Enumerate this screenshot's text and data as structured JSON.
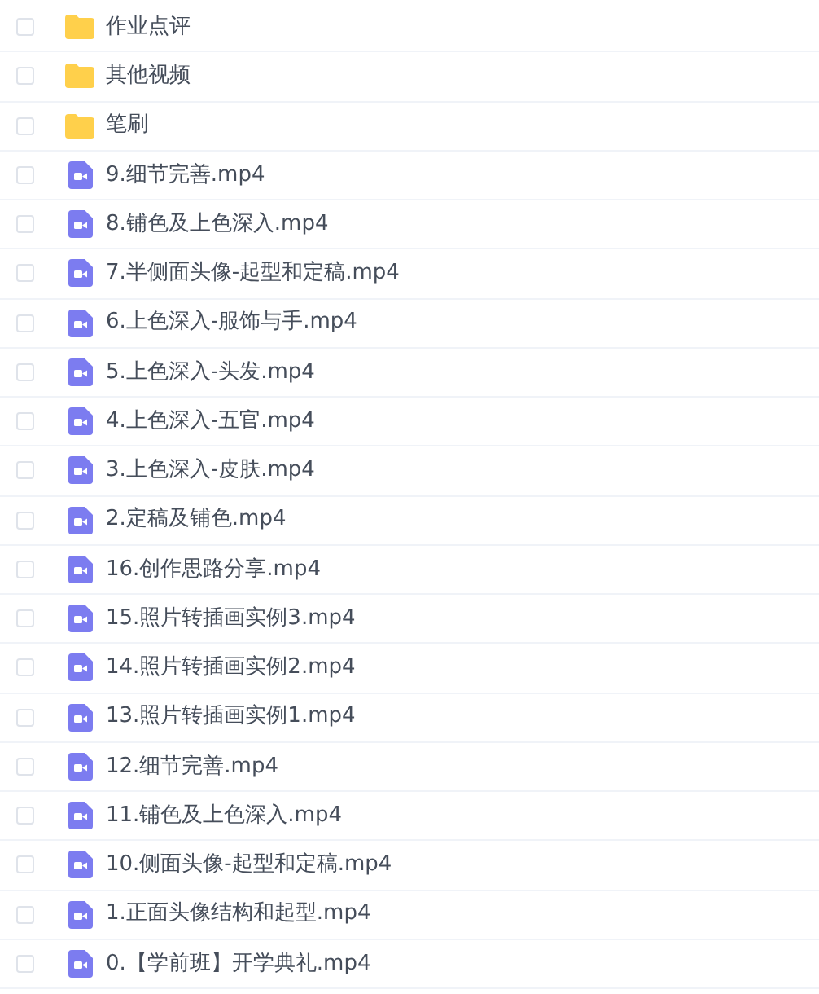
{
  "files": [
    {
      "kind": "folder",
      "name": "作业点评",
      "checked": false
    },
    {
      "kind": "folder",
      "name": "其他视频",
      "checked": false
    },
    {
      "kind": "folder",
      "name": "笔刷",
      "checked": false
    },
    {
      "kind": "video",
      "name": "9.细节完善.mp4",
      "checked": false
    },
    {
      "kind": "video",
      "name": "8.铺色及上色深入.mp4",
      "checked": false
    },
    {
      "kind": "video",
      "name": "7.半侧面头像-起型和定稿.mp4",
      "checked": false
    },
    {
      "kind": "video",
      "name": "6.上色深入-服饰与手.mp4",
      "checked": false
    },
    {
      "kind": "video",
      "name": "5.上色深入-头发.mp4",
      "checked": false
    },
    {
      "kind": "video",
      "name": "4.上色深入-五官.mp4",
      "checked": false
    },
    {
      "kind": "video",
      "name": "3.上色深入-皮肤.mp4",
      "checked": false
    },
    {
      "kind": "video",
      "name": "2.定稿及铺色.mp4",
      "checked": false
    },
    {
      "kind": "video",
      "name": "16.创作思路分享.mp4",
      "checked": false
    },
    {
      "kind": "video",
      "name": "15.照片转插画实例3.mp4",
      "checked": false
    },
    {
      "kind": "video",
      "name": "14.照片转插画实例2.mp4",
      "checked": false
    },
    {
      "kind": "video",
      "name": "13.照片转插画实例1.mp4",
      "checked": false
    },
    {
      "kind": "video",
      "name": "12.细节完善.mp4",
      "checked": false
    },
    {
      "kind": "video",
      "name": "11.铺色及上色深入.mp4",
      "checked": false
    },
    {
      "kind": "video",
      "name": "10.侧面头像-起型和定稿.mp4",
      "checked": false
    },
    {
      "kind": "video",
      "name": "1.正面头像结构和起型.mp4",
      "checked": false
    },
    {
      "kind": "video",
      "name": "0.【学前班】开学典礼.mp4",
      "checked": false
    }
  ]
}
